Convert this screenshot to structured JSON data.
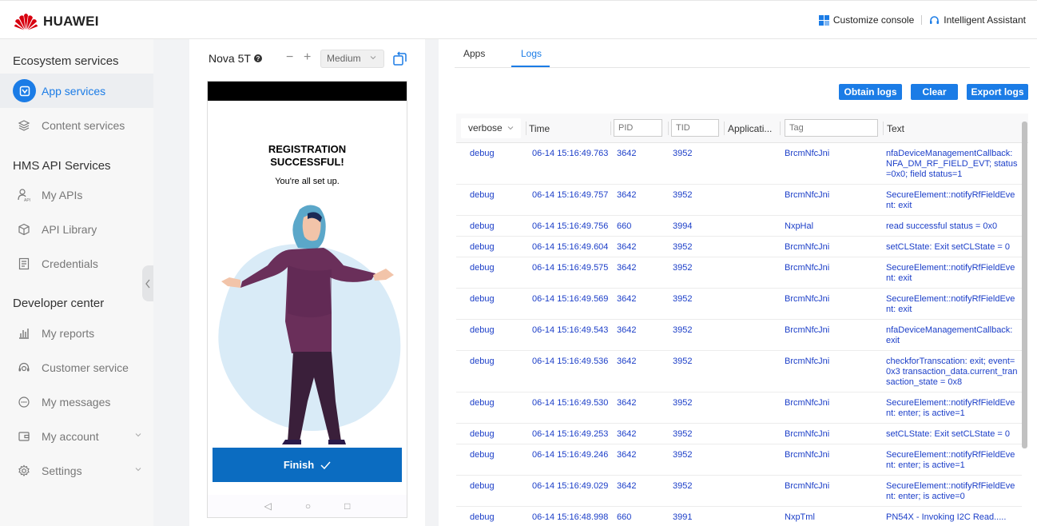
{
  "header": {
    "brand": "HUAWEI",
    "customize_console": "Customize console",
    "intelligent_assistant": "Intelligent Assistant"
  },
  "sidebar": {
    "sections": [
      {
        "title": "Ecosystem services"
      },
      {
        "title": "HMS API Services"
      },
      {
        "title": "Developer center"
      }
    ],
    "items": [
      {
        "label": "App services",
        "icon": "app-services-icon",
        "active": true
      },
      {
        "label": "Content services",
        "icon": "layers-icon"
      },
      {
        "label": "My APIs",
        "icon": "user-api-icon"
      },
      {
        "label": "API Library",
        "icon": "cube-icon"
      },
      {
        "label": "Credentials",
        "icon": "document-icon"
      },
      {
        "label": "My reports",
        "icon": "bar-chart-icon"
      },
      {
        "label": "Customer service",
        "icon": "headset-icon"
      },
      {
        "label": "My messages",
        "icon": "chat-icon"
      },
      {
        "label": "My account",
        "icon": "wallet-icon"
      },
      {
        "label": "Settings",
        "icon": "gear-icon"
      }
    ]
  },
  "device": {
    "name": "Nova 5T",
    "minus": "−",
    "plus": "+",
    "size": "Medium",
    "screen": {
      "title_line1": "REGISTRATION",
      "title_line2": "SUCCESSFUL!",
      "subtitle": "You're all set up.",
      "finish_label": "Finish",
      "nav_back": "◁",
      "nav_home": "○",
      "nav_recent": "□"
    }
  },
  "tabs": [
    {
      "label": "Apps"
    },
    {
      "label": "Logs",
      "active": true
    }
  ],
  "actions": {
    "obtain_logs": "Obtain logs",
    "clear": "Clear",
    "export_logs": "Export logs"
  },
  "log_table": {
    "level_filter": "verbose",
    "headers": {
      "time": "Time",
      "application": "Applicati...",
      "text": "Text"
    },
    "placeholders": {
      "pid": "PID",
      "tid": "TID",
      "tag": "Tag"
    },
    "rows": [
      {
        "level": "debug",
        "time": "06-14 15:16:49.763",
        "pid": "3642",
        "tid": "3952",
        "tag": "BrcmNfcJni",
        "text": "nfaDeviceManagementCallback: NFA_DM_RF_FIELD_EVT; status=0x0; field status=1"
      },
      {
        "level": "debug",
        "time": "06-14 15:16:49.757",
        "pid": "3642",
        "tid": "3952",
        "tag": "BrcmNfcJni",
        "text": "SecureElement::notifyRfFieldEvent: exit"
      },
      {
        "level": "debug",
        "time": "06-14 15:16:49.756",
        "pid": "660",
        "tid": "3994",
        "tag": "NxpHal",
        "text": "read successful status = 0x0"
      },
      {
        "level": "debug",
        "time": "06-14 15:16:49.604",
        "pid": "3642",
        "tid": "3952",
        "tag": "BrcmNfcJni",
        "text": "setCLState: Exit setCLState = 0"
      },
      {
        "level": "debug",
        "time": "06-14 15:16:49.575",
        "pid": "3642",
        "tid": "3952",
        "tag": "BrcmNfcJni",
        "text": "SecureElement::notifyRfFieldEvent: exit"
      },
      {
        "level": "debug",
        "time": "06-14 15:16:49.569",
        "pid": "3642",
        "tid": "3952",
        "tag": "BrcmNfcJni",
        "text": "SecureElement::notifyRfFieldEvent: exit"
      },
      {
        "level": "debug",
        "time": "06-14 15:16:49.543",
        "pid": "3642",
        "tid": "3952",
        "tag": "BrcmNfcJni",
        "text": "nfaDeviceManagementCallback: exit"
      },
      {
        "level": "debug",
        "time": "06-14 15:16:49.536",
        "pid": "3642",
        "tid": "3952",
        "tag": "BrcmNfcJni",
        "text": "checkforTranscation: exit; event=0x3 transaction_data.current_transaction_state = 0x8"
      },
      {
        "level": "debug",
        "time": "06-14 15:16:49.530",
        "pid": "3642",
        "tid": "3952",
        "tag": "BrcmNfcJni",
        "text": "SecureElement::notifyRfFieldEvent: enter; is active=1"
      },
      {
        "level": "debug",
        "time": "06-14 15:16:49.253",
        "pid": "3642",
        "tid": "3952",
        "tag": "BrcmNfcJni",
        "text": "setCLState: Exit setCLState = 0"
      },
      {
        "level": "debug",
        "time": "06-14 15:16:49.246",
        "pid": "3642",
        "tid": "3952",
        "tag": "BrcmNfcJni",
        "text": "SecureElement::notifyRfFieldEvent: enter; is active=1"
      },
      {
        "level": "debug",
        "time": "06-14 15:16:49.029",
        "pid": "3642",
        "tid": "3952",
        "tag": "BrcmNfcJni",
        "text": "SecureElement::notifyRfFieldEvent: enter; is active=0"
      },
      {
        "level": "debug",
        "time": "06-14 15:16:48.998",
        "pid": "660",
        "tid": "3991",
        "tag": "NxpTml",
        "text": "PN54X - Invoking I2C Read....."
      }
    ]
  }
}
